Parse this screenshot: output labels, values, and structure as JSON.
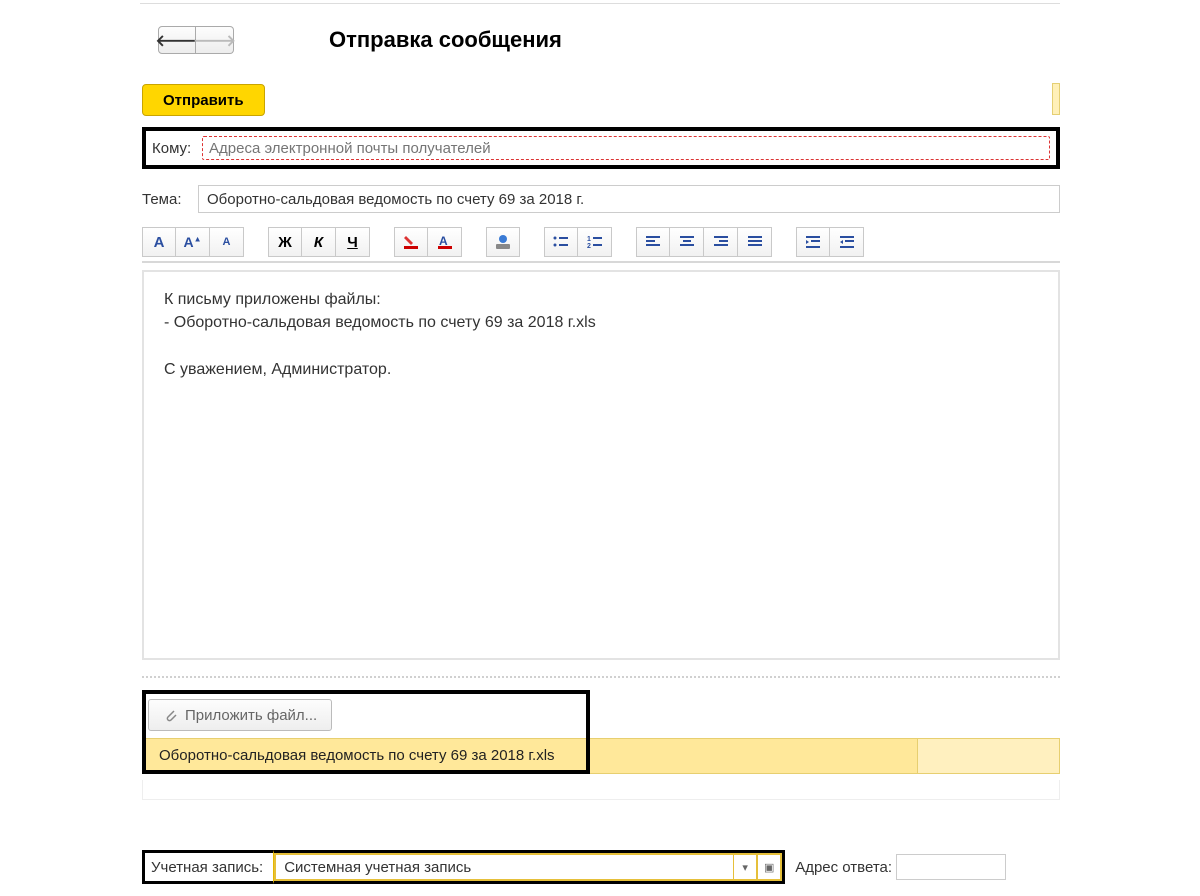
{
  "header": {
    "title": "Отправка сообщения"
  },
  "actions": {
    "send_label": "Отправить"
  },
  "fields": {
    "to_label": "Кому:",
    "to_placeholder": "Адреса электронной почты получателей",
    "to_value": "",
    "subject_label": "Тема:",
    "subject_value": "Оборотно-сальдовая ведомость по счету 69 за 2018 г."
  },
  "body": {
    "line1": "К письму приложены файлы:",
    "line2": "- Оборотно-сальдовая ведомость по счету 69 за 2018 г.xls",
    "line3": "С уважением, Администратор."
  },
  "attach": {
    "button_label": "Приложить файл...",
    "items": [
      "Оборотно-сальдовая ведомость по счету 69 за 2018 г.xls"
    ]
  },
  "footer": {
    "account_label": "Учетная запись:",
    "account_value": "Системная учетная запись",
    "reply_label": "Адрес ответа:",
    "reply_value": ""
  },
  "toolbar": {
    "font_A": "A",
    "bold": "Ж",
    "italic": "К",
    "underline": "Ч"
  }
}
